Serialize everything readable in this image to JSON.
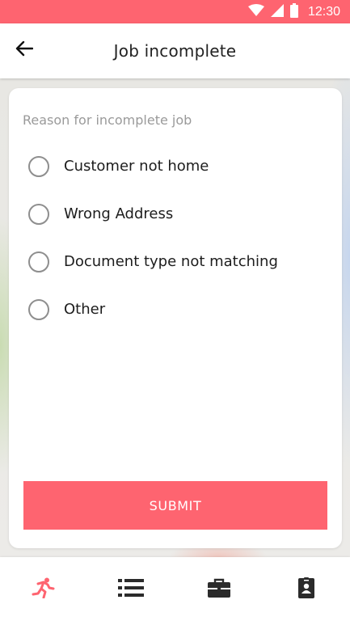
{
  "status_bar": {
    "time": "12:30",
    "icons": [
      "wifi-icon",
      "signal-icon",
      "battery-icon"
    ]
  },
  "app_bar": {
    "back_icon": "arrow-left-icon",
    "title": "Job incomplete"
  },
  "form": {
    "label": "Reason for incomplete job",
    "options": [
      {
        "label": "Customer not home",
        "selected": false
      },
      {
        "label": "Wrong Address",
        "selected": false
      },
      {
        "label": "Document type not matching",
        "selected": false
      },
      {
        "label": "Other",
        "selected": false
      }
    ],
    "submit_label": "SUBMIT"
  },
  "bottom_nav": {
    "items": [
      {
        "icon": "running-person-icon",
        "active": true
      },
      {
        "icon": "list-icon",
        "active": false
      },
      {
        "icon": "briefcase-icon",
        "active": false
      },
      {
        "icon": "id-badge-icon",
        "active": false
      }
    ]
  },
  "colors": {
    "accent": "#fe6470",
    "nav_inactive": "#2b2b2b",
    "text_primary": "#1d1d1d",
    "text_secondary": "#9a9a9a"
  }
}
